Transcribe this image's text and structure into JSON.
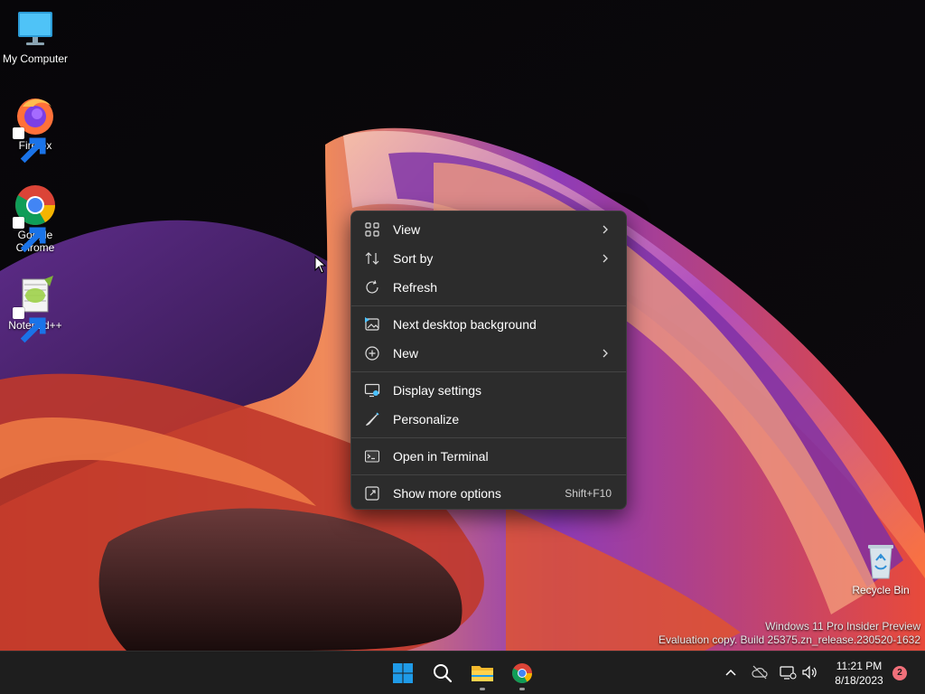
{
  "desktop": {
    "icons": [
      {
        "label": "My Computer",
        "icon": "monitor-icon"
      },
      {
        "label": "Firefox",
        "icon": "firefox-icon",
        "shortcut": true
      },
      {
        "label": "Google Chrome",
        "icon": "chrome-icon",
        "shortcut": true
      },
      {
        "label": "Notepad++",
        "icon": "notepad-plus-plus-icon",
        "shortcut": true
      },
      {
        "label": "Recycle Bin",
        "icon": "recycle-bin-icon"
      }
    ]
  },
  "context_menu": {
    "items": [
      {
        "label": "View",
        "icon": "grid-icon",
        "submenu": true
      },
      {
        "label": "Sort by",
        "icon": "sort-arrows-icon",
        "submenu": true
      },
      {
        "label": "Refresh",
        "icon": "refresh-icon"
      },
      {
        "label": "Next desktop background",
        "icon": "next-background-icon"
      },
      {
        "label": "New",
        "icon": "add-circle-icon",
        "submenu": true
      },
      {
        "label": "Display settings",
        "icon": "display-settings-icon"
      },
      {
        "label": "Personalize",
        "icon": "brush-icon"
      },
      {
        "label": "Open in Terminal",
        "icon": "terminal-icon"
      },
      {
        "label": "Show more options",
        "icon": "more-options-icon",
        "shortcut": "Shift+F10"
      }
    ]
  },
  "watermark": {
    "line1": "Windows 11 Pro Insider Preview",
    "line2": "Evaluation copy. Build 25375.zn_release.230520-1632"
  },
  "taskbar": {
    "apps": [
      "start-icon",
      "search-icon",
      "file-explorer-icon",
      "chrome-icon"
    ],
    "tray": [
      "chevron-up-icon",
      "cloud-off-icon",
      "network-icon",
      "volume-icon"
    ],
    "clock": {
      "time": "11:21 PM",
      "date": "8/18/2023"
    },
    "notification_count": "2"
  },
  "colors": {
    "menu_bg": "#2c2c2c",
    "taskbar_bg": "#1e1e1e",
    "accent": "#0078d4"
  }
}
